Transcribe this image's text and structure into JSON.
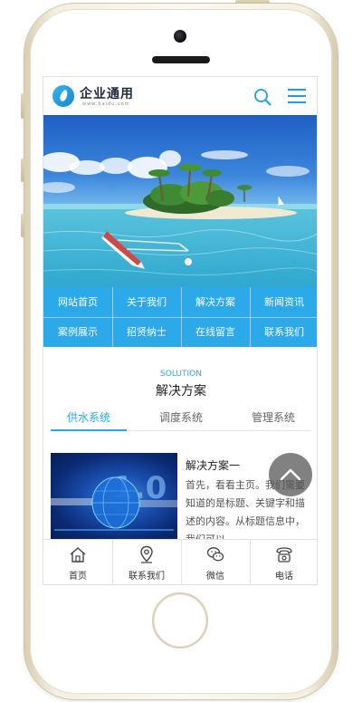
{
  "header": {
    "logo_title": "企业通用",
    "logo_subtitle": "www.baidu.com",
    "icons": {
      "search": "search-icon",
      "menu": "hamburger-menu-icon"
    },
    "accent_color": "#2ba9e8"
  },
  "nav": {
    "items": [
      "网站首页",
      "关于我们",
      "解决方案",
      "新闻资讯",
      "案例展示",
      "招贤纳士",
      "在线留言",
      "联系我们"
    ]
  },
  "solution": {
    "title_en": "SOLUTION",
    "title_cn": "解决方案",
    "tabs": [
      {
        "label": "供水系统",
        "active": true
      },
      {
        "label": "调度系统",
        "active": false
      },
      {
        "label": "管理系统",
        "active": false
      }
    ],
    "card": {
      "title": "解决方案一",
      "description": "首先，看看主页。我们需要知道的是标题、关键字和描述的内容。从标题信息中，我们可以"
    }
  },
  "bottom_bar": {
    "items": [
      {
        "label": "首页",
        "icon": "home-icon"
      },
      {
        "label": "联系我们",
        "icon": "location-pin-icon"
      },
      {
        "label": "微信",
        "icon": "wechat-icon"
      },
      {
        "label": "电话",
        "icon": "telephone-icon"
      }
    ]
  }
}
